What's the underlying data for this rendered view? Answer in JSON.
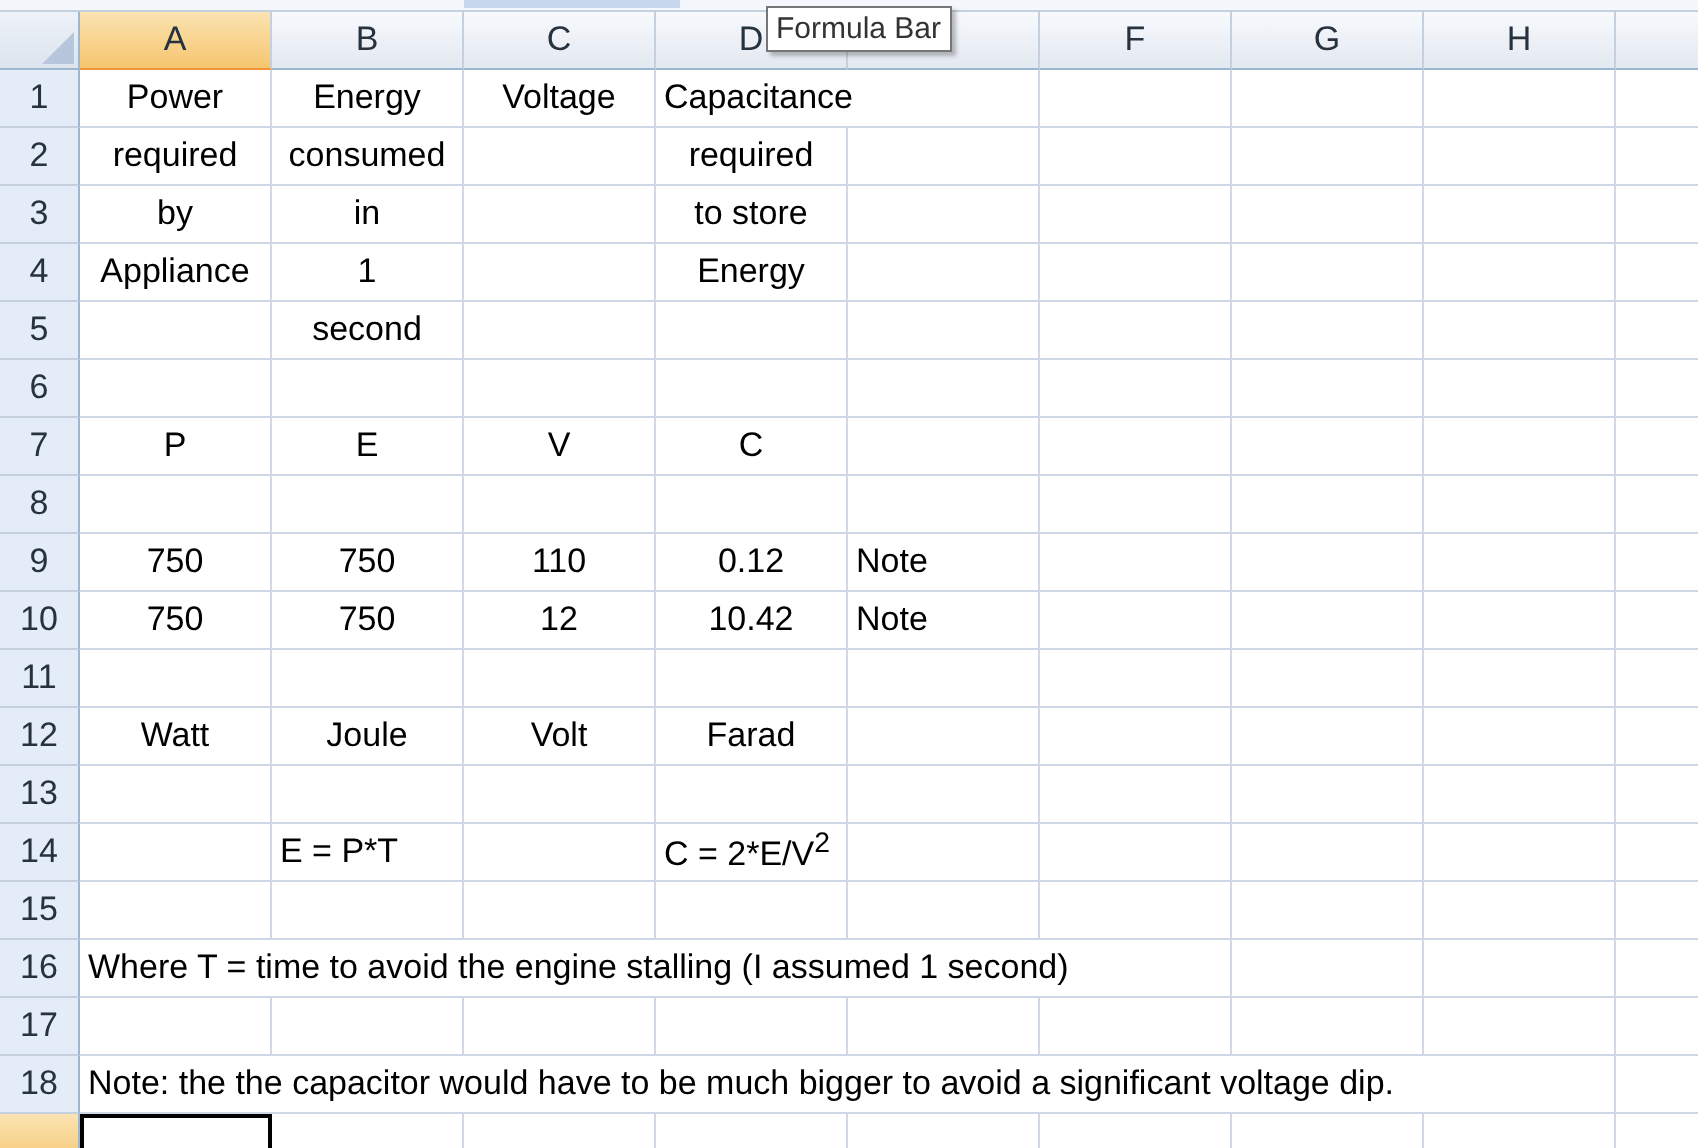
{
  "columns": [
    {
      "label": "A",
      "selected": true
    },
    {
      "label": "B",
      "selected": false
    },
    {
      "label": "C",
      "selected": false
    },
    {
      "label": "D",
      "selected": false
    },
    {
      "selected": false
    },
    {
      "label": "F",
      "selected": false
    },
    {
      "label": "G",
      "selected": false
    },
    {
      "label": "H",
      "selected": false
    }
  ],
  "tooltip": "Formula Bar",
  "rows": [
    {
      "label": "1",
      "selected": false,
      "cells": {
        "A": {
          "text": "Power",
          "left_aligned": false
        },
        "B": {
          "text": "Energy",
          "left_aligned": false
        },
        "C": {
          "text": "Voltage",
          "left_aligned": false
        },
        "D": {
          "text": "Capacitance",
          "left_aligned": true
        }
      }
    },
    {
      "label": "2",
      "selected": false,
      "cells": {
        "A": {
          "text": "required",
          "left_aligned": false
        },
        "B": {
          "text": "consumed",
          "left_aligned": false
        },
        "D": {
          "text": "required",
          "left_aligned": false
        }
      }
    },
    {
      "label": "3",
      "selected": false,
      "cells": {
        "A": {
          "text": "by",
          "left_aligned": false
        },
        "B": {
          "text": "in",
          "left_aligned": false
        },
        "D": {
          "text": "to store",
          "left_aligned": false
        }
      }
    },
    {
      "label": "4",
      "selected": false,
      "cells": {
        "A": {
          "text": "Appliance",
          "left_aligned": false
        },
        "B": {
          "text": "1",
          "left_aligned": false
        },
        "D": {
          "text": "Energy",
          "left_aligned": false
        }
      }
    },
    {
      "label": "5",
      "selected": false,
      "cells": {
        "B": {
          "text": "second",
          "left_aligned": false
        }
      }
    },
    {
      "label": "6",
      "selected": false
    },
    {
      "label": "7",
      "selected": false,
      "cells": {
        "A": {
          "text": "P",
          "left_aligned": false
        },
        "B": {
          "text": "E",
          "left_aligned": false
        },
        "C": {
          "text": "V",
          "left_aligned": false
        },
        "D": {
          "text": "C",
          "left_aligned": false
        }
      }
    },
    {
      "label": "8",
      "selected": false
    },
    {
      "label": "9",
      "selected": false,
      "cells": {
        "A": {
          "text": "750",
          "left_aligned": false
        },
        "B": {
          "text": "750",
          "left_aligned": false
        },
        "C": {
          "text": "110",
          "left_aligned": false
        },
        "D": {
          "text": "0.12",
          "left_aligned": false
        },
        "E": {
          "text": "Note",
          "left_aligned": true
        }
      }
    },
    {
      "label": "10",
      "selected": false,
      "cells": {
        "A": {
          "text": "750",
          "left_aligned": false
        },
        "B": {
          "text": "750",
          "left_aligned": false
        },
        "C": {
          "text": "12",
          "left_aligned": false
        },
        "D": {
          "text": "10.42",
          "left_aligned": false
        },
        "E": {
          "text": "Note",
          "left_aligned": true
        }
      }
    },
    {
      "label": "11",
      "selected": false
    },
    {
      "label": "12",
      "selected": false,
      "cells": {
        "A": {
          "text": "Watt",
          "left_aligned": false
        },
        "B": {
          "text": "Joule",
          "left_aligned": false
        },
        "C": {
          "text": "Volt",
          "left_aligned": false
        },
        "D": {
          "text": "Farad",
          "left_aligned": false
        }
      }
    },
    {
      "label": "13",
      "selected": false
    },
    {
      "label": "14",
      "selected": false,
      "cells": {
        "B": {
          "text": "E = P*T",
          "left_aligned": true
        },
        "D": {
          "text": "C = 2*E/V$^{2}$",
          "left_aligned": true
        }
      }
    },
    {
      "label": "15",
      "selected": false
    },
    {
      "label": "16",
      "selected": false,
      "cells": {
        "A": {
          "text": "Where T = time to avoid the engine stalling (I assumed 1 second)",
          "left_aligned": true
        }
      }
    },
    {
      "label": "17",
      "selected": false
    },
    {
      "label": "18",
      "selected": false,
      "cells": {
        "A": {
          "text": "Note: the the capacitor would have to be much bigger to avoid a significant voltage dip.",
          "left_aligned": true
        }
      }
    },
    {
      "selected": true
    }
  ]
}
